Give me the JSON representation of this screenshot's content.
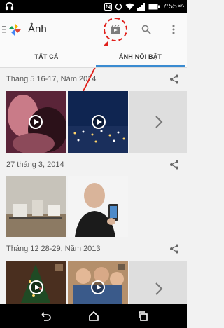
{
  "status_bar": {
    "time": "7:55",
    "time_suffix": "SA",
    "icons": [
      "headphones-icon",
      "nfc-icon",
      "sync-icon",
      "wifi-icon",
      "signal-icon",
      "battery-icon"
    ]
  },
  "app_bar": {
    "title": "Ảnh",
    "icons": [
      "drawer-icon",
      "photos-logo",
      "highlight-video-icon",
      "search-icon",
      "overflow-menu-icon"
    ]
  },
  "tabs": [
    {
      "label": "TẤT CẢ",
      "selected": false
    },
    {
      "label": "ẢNH NỔI BẬT",
      "selected": true
    }
  ],
  "sections": [
    {
      "label": "Tháng 5 16-17, Năm 2014"
    },
    {
      "label": "27 tháng 3, 2014"
    },
    {
      "label": "Tháng 12 28-29, Năm 2013"
    }
  ],
  "nav_bar": {
    "icons": [
      "back-icon",
      "home-icon",
      "recent-apps-icon"
    ]
  },
  "colors": {
    "tab_indicator": "#3a8bd1",
    "annotation": "#e0201b"
  }
}
